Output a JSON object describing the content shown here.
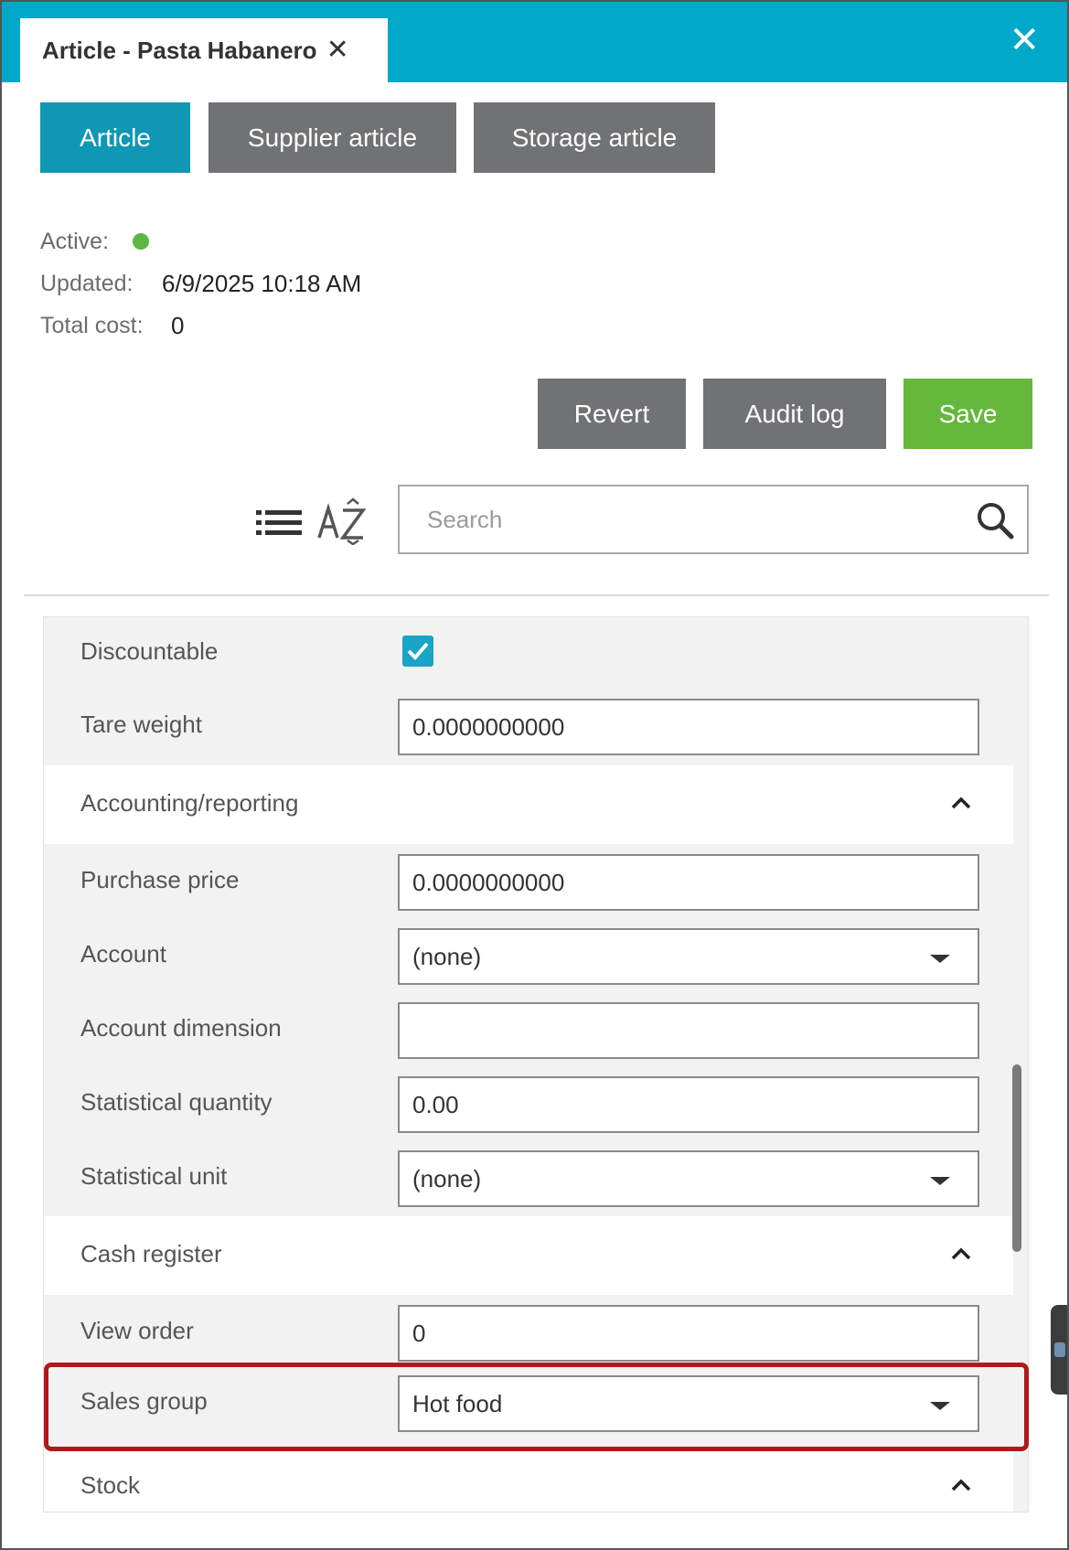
{
  "tab": {
    "title": "Article - Pasta Habanero",
    "close_glyph": "✕"
  },
  "window_close_glyph": "✕",
  "view_tabs": [
    "Article",
    "Supplier article",
    "Storage article"
  ],
  "meta": {
    "active_label": "Active:",
    "active_color": "#5cb840",
    "updated_label": "Updated:",
    "updated_value": "6/9/2025 10:18 AM",
    "total_cost_label": "Total cost:",
    "total_cost_value": "0"
  },
  "actions": {
    "revert": "Revert",
    "audit_log": "Audit log",
    "save": "Save"
  },
  "search": {
    "placeholder": "Search",
    "value": ""
  },
  "fields": {
    "discountable": {
      "label": "Discountable",
      "checked": true
    },
    "tare_weight": {
      "label": "Tare weight",
      "value": "0.0000000000"
    }
  },
  "sections": {
    "accounting": {
      "title": "Accounting/reporting",
      "purchase_price": {
        "label": "Purchase price",
        "value": "0.0000000000"
      },
      "account": {
        "label": "Account",
        "value": "(none)"
      },
      "account_dimension": {
        "label": "Account dimension",
        "value": ""
      },
      "statistical_quantity": {
        "label": "Statistical quantity",
        "value": "0.00"
      },
      "statistical_unit": {
        "label": "Statistical unit",
        "value": "(none)"
      }
    },
    "cash_register": {
      "title": "Cash register",
      "view_order": {
        "label": "View order",
        "value": "0"
      },
      "sales_group": {
        "label": "Sales group",
        "value": "Hot food"
      }
    },
    "stock": {
      "title": "Stock"
    }
  },
  "colors": {
    "header_bg": "#00a8c9",
    "primary": "#0f97b3",
    "secondary": "#717273",
    "save": "#66b83c",
    "highlight": "#b0191b"
  }
}
